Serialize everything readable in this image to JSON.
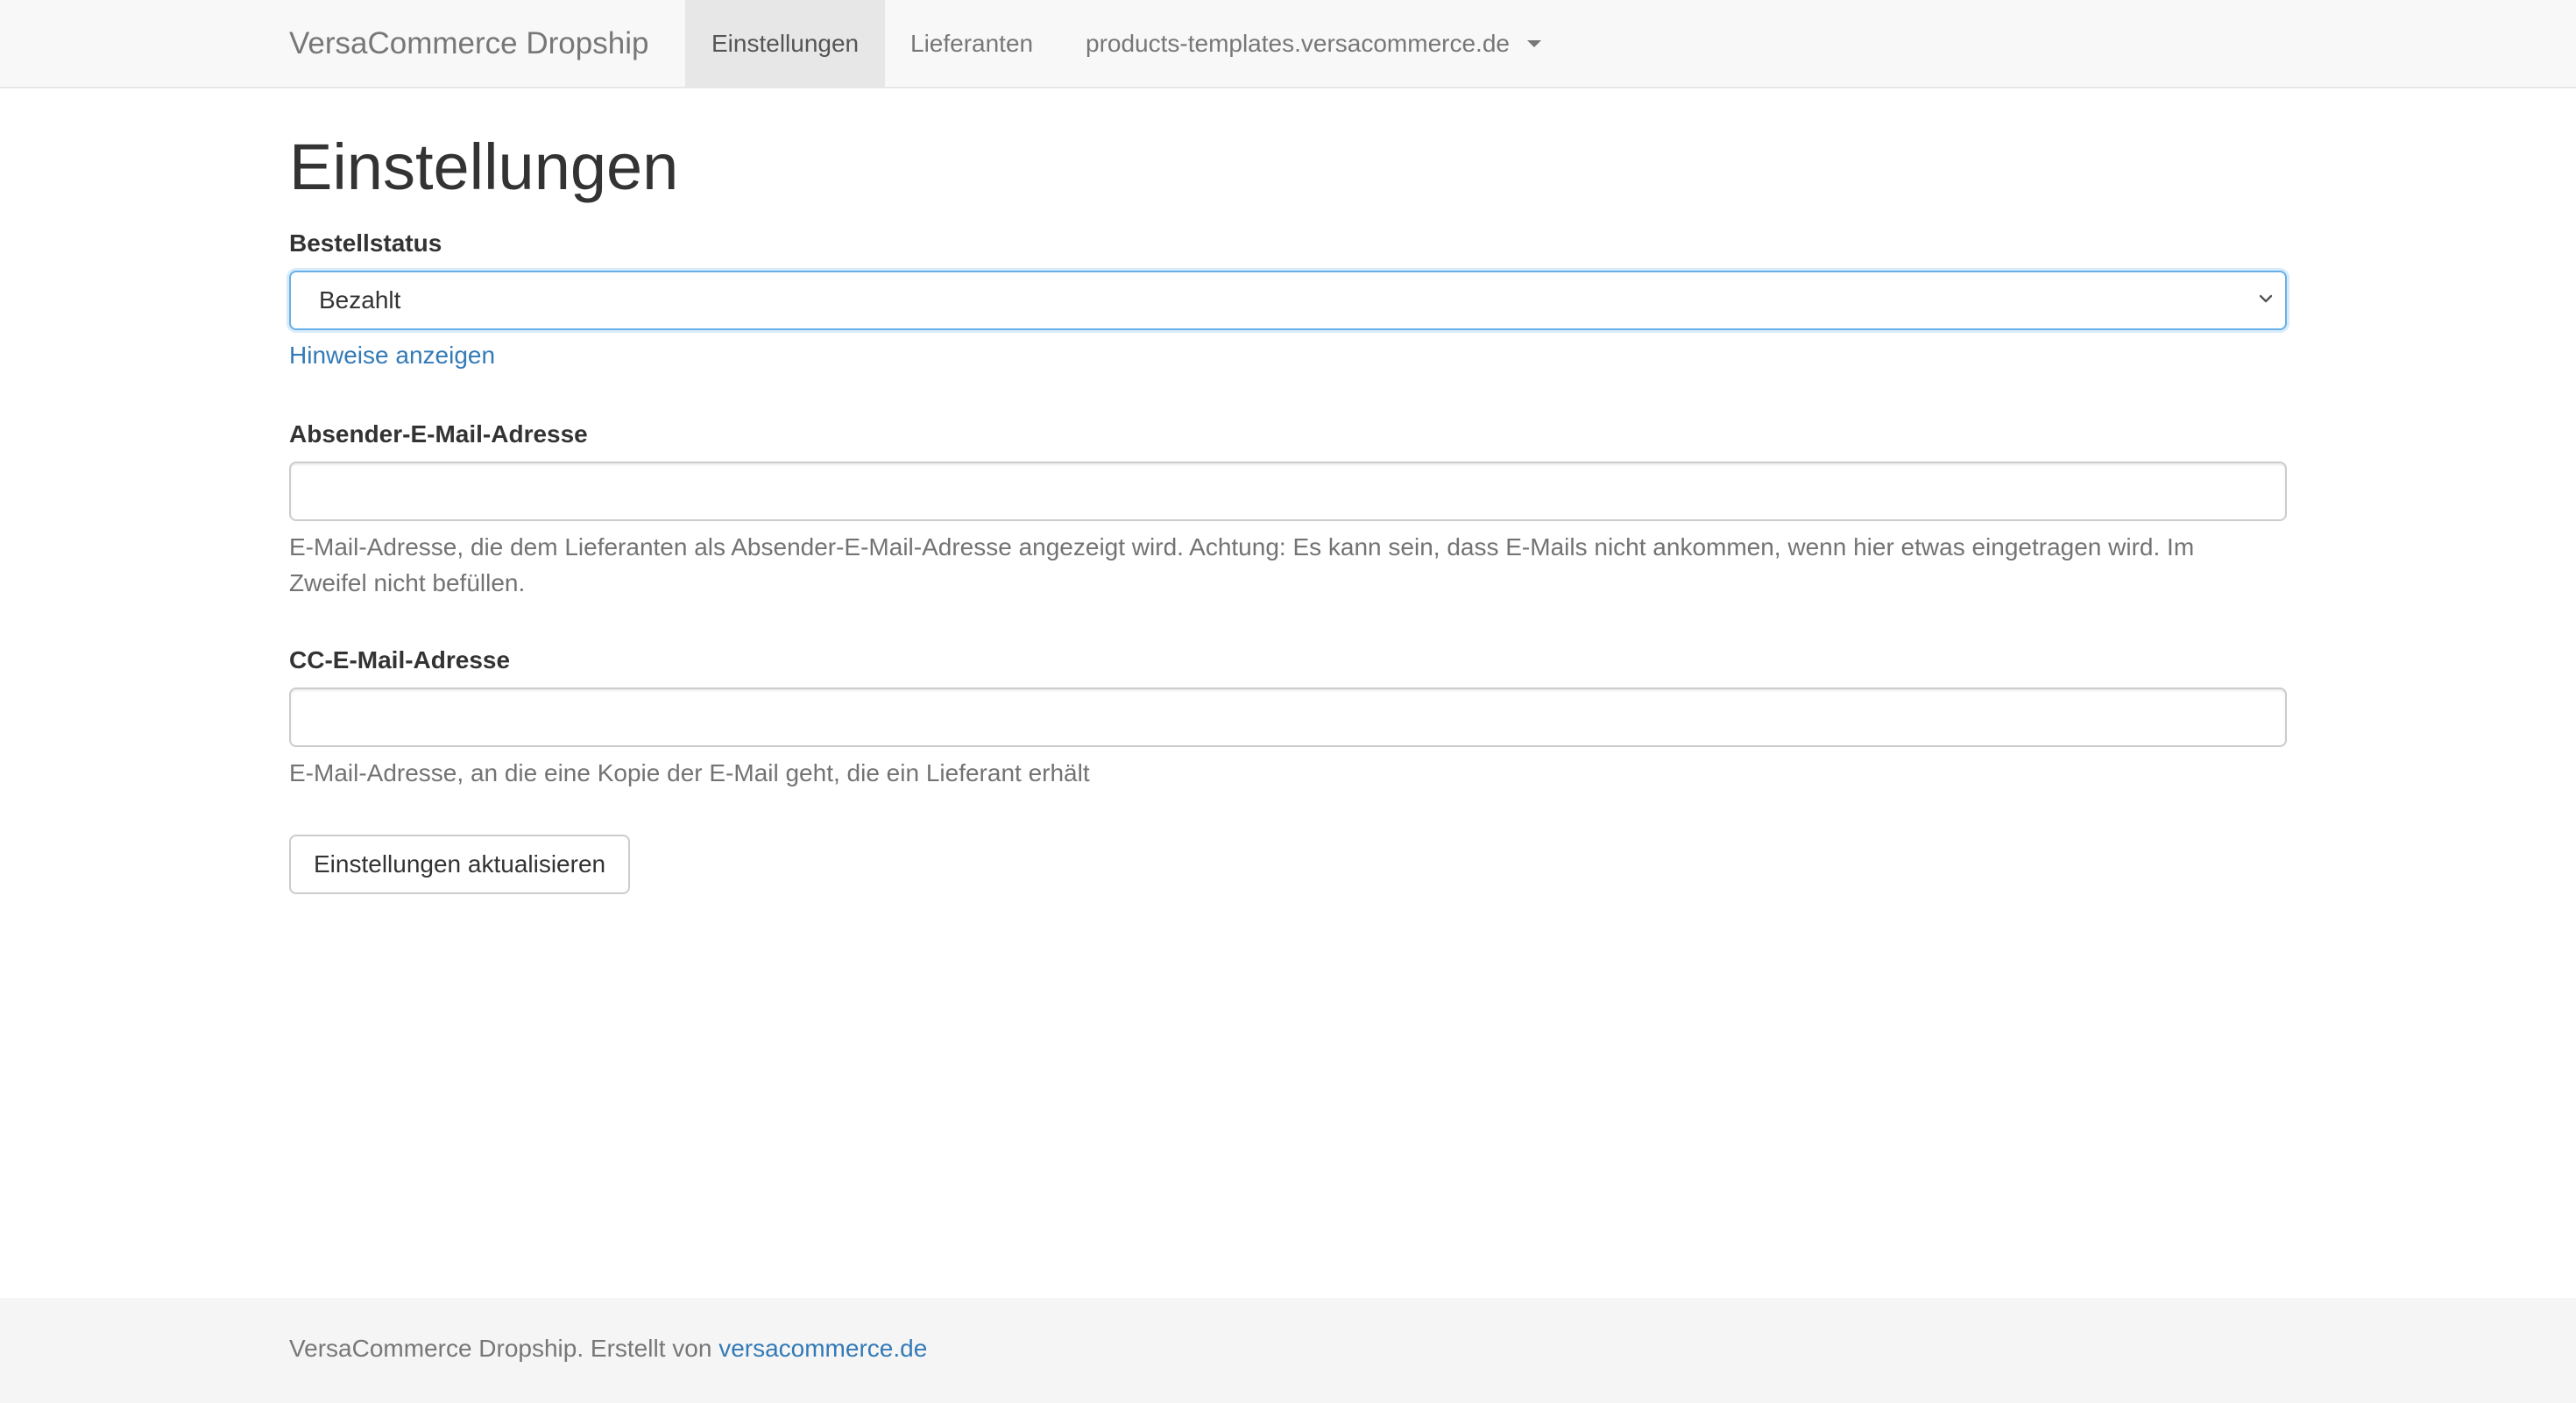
{
  "navbar": {
    "brand": "VersaCommerce Dropship",
    "items": [
      {
        "label": "Einstellungen",
        "active": true
      },
      {
        "label": "Lieferanten",
        "active": false
      },
      {
        "label": "products-templates.versacommerce.de",
        "active": false,
        "has_dropdown": true
      }
    ]
  },
  "main": {
    "title": "Einstellungen",
    "order_status": {
      "label": "Bestellstatus",
      "selected": "Bezahlt",
      "hints_link": "Hinweise anzeigen"
    },
    "sender_email": {
      "label": "Absender-E-Mail-Adresse",
      "value": "",
      "help": "E-Mail-Adresse, die dem Lieferanten als Absender-E-Mail-Adresse angezeigt wird. Achtung: Es kann sein, dass E-Mails nicht ankommen, wenn hier etwas eingetragen wird. Im Zweifel nicht befüllen."
    },
    "cc_email": {
      "label": "CC-E-Mail-Adresse",
      "value": "",
      "help": "E-Mail-Adresse, an die eine Kopie der E-Mail geht, die ein Lieferant erhält"
    },
    "submit_label": "Einstellungen aktualisieren"
  },
  "footer": {
    "text": "VersaCommerce Dropship. Erstellt von",
    "link_text": "versacommerce.de"
  },
  "colors": {
    "link": "#337ab7",
    "focus_border": "#66afe9",
    "navbar_bg": "#f8f8f8",
    "active_tab_bg": "#e7e7e7",
    "footer_bg": "#f5f5f5"
  }
}
